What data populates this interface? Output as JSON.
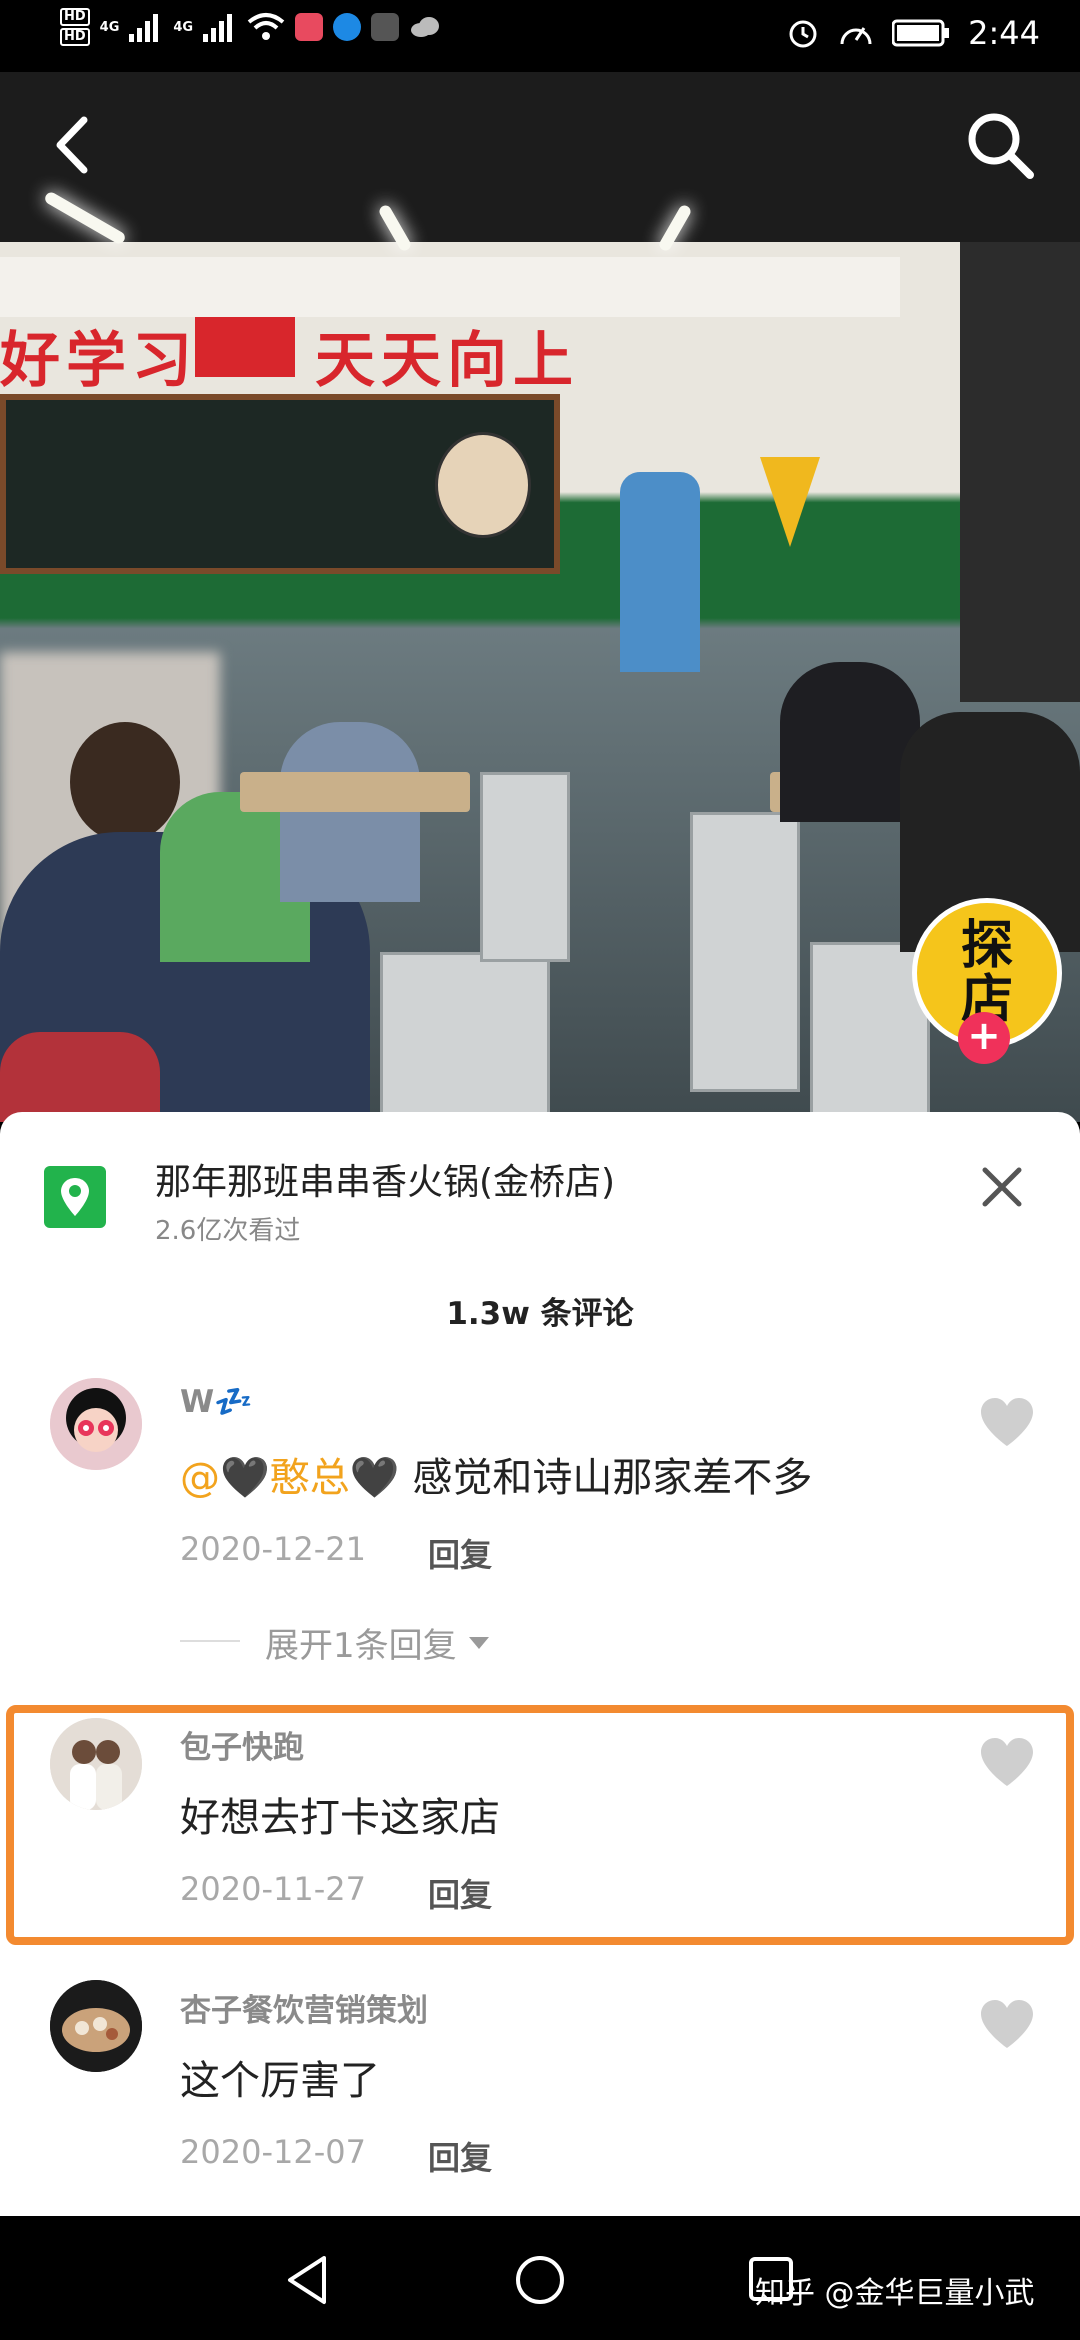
{
  "status_bar": {
    "hd1": "HD",
    "hd2": "HD",
    "signal1": "4G",
    "signal2": "4G",
    "time": "2:44"
  },
  "video": {
    "banner_left": "好学习",
    "banner_right": "天天向上",
    "icons": [
      "back-arrow-icon",
      "search-icon"
    ],
    "badge_label": "探店",
    "badge_add": "+"
  },
  "location": {
    "name": "那年那班串串香火锅(金桥店)",
    "views": "2.6亿次看过",
    "icon": "location-pin-icon"
  },
  "comments_header": "1.3w 条评论",
  "comments": [
    {
      "name": "W💤",
      "mention": "@🖤憨总🖤",
      "text": " 感觉和诗山那家差不多",
      "date": "2020-12-21",
      "reply": "回复"
    },
    {
      "name": "包子快跑",
      "text": "好想去打卡这家店",
      "date": "2020-11-27",
      "reply": "回复"
    },
    {
      "name": "杏子餐饮营销策划",
      "text": "这个厉害了",
      "date": "2020-12-07",
      "reply": "回复"
    }
  ],
  "expand_replies": "展开1条回复",
  "watermark": "知乎 @金华巨量小武",
  "colors": {
    "highlight": "#f38a30",
    "location_green": "#22b34c",
    "mention": "#f2a31d",
    "badge_yellow": "#f5c51b",
    "badge_plus": "#f0315a"
  }
}
